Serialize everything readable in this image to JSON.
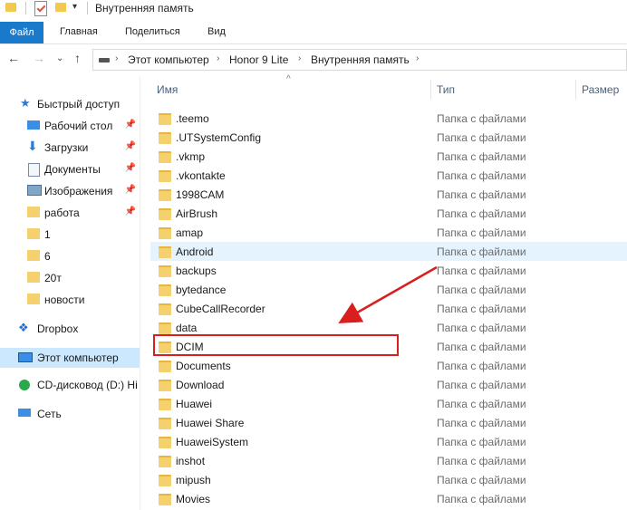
{
  "window": {
    "title": "Внутренняя память"
  },
  "ribbon": {
    "tabs": [
      "Файл",
      "Главная",
      "Поделиться",
      "Вид"
    ]
  },
  "address": {
    "crumbs": [
      "Этот компьютер",
      "Honor 9 Lite",
      "Внутренняя память"
    ]
  },
  "sidebar": {
    "items": [
      {
        "label": "Быстрый доступ",
        "icon": "star-icon",
        "pinned": false
      },
      {
        "label": "Рабочий стол",
        "icon": "desktop-icon",
        "pinned": true
      },
      {
        "label": "Загрузки",
        "icon": "download-arrow-icon",
        "pinned": true
      },
      {
        "label": "Документы",
        "icon": "documents-icon",
        "pinned": true
      },
      {
        "label": "Изображения",
        "icon": "pictures-icon",
        "pinned": true
      },
      {
        "label": "работа",
        "icon": "folder-sync-icon",
        "pinned": true
      },
      {
        "label": "1",
        "icon": "folder-icon",
        "pinned": false
      },
      {
        "label": "6",
        "icon": "folder-icon",
        "pinned": false
      },
      {
        "label": "20т",
        "icon": "folder-icon",
        "pinned": false
      },
      {
        "label": "новости",
        "icon": "folder-icon",
        "pinned": false
      },
      {
        "label": "Dropbox",
        "icon": "dropbox-icon",
        "pinned": false
      },
      {
        "label": "Этот компьютер",
        "icon": "computer-icon",
        "pinned": false,
        "selected": true
      },
      {
        "label": "CD-дисковод (D:) Hi",
        "icon": "cd-drive-icon",
        "pinned": false
      },
      {
        "label": "Сеть",
        "icon": "network-icon",
        "pinned": false
      }
    ]
  },
  "columns": {
    "name": "Имя",
    "type": "Тип",
    "size": "Размер"
  },
  "files": [
    {
      "name": ".teemo",
      "type": "Папка с файлами"
    },
    {
      "name": ".UTSystemConfig",
      "type": "Папка с файлами"
    },
    {
      "name": ".vkmp",
      "type": "Папка с файлами"
    },
    {
      "name": ".vkontakte",
      "type": "Папка с файлами"
    },
    {
      "name": "1998CAM",
      "type": "Папка с файлами"
    },
    {
      "name": "AirBrush",
      "type": "Папка с файлами"
    },
    {
      "name": "amap",
      "type": "Папка с файлами"
    },
    {
      "name": "Android",
      "type": "Папка с файлами"
    },
    {
      "name": "backups",
      "type": "Папка с файлами"
    },
    {
      "name": "bytedance",
      "type": "Папка с файлами"
    },
    {
      "name": "CubeCallRecorder",
      "type": "Папка с файлами"
    },
    {
      "name": "data",
      "type": "Папка с файлами"
    },
    {
      "name": "DCIM",
      "type": "Папка с файлами"
    },
    {
      "name": "Documents",
      "type": "Папка с файлами"
    },
    {
      "name": "Download",
      "type": "Папка с файлами"
    },
    {
      "name": "Huawei",
      "type": "Папка с файлами"
    },
    {
      "name": "Huawei Share",
      "type": "Папка с файлами"
    },
    {
      "name": "HuaweiSystem",
      "type": "Папка с файлами"
    },
    {
      "name": "inshot",
      "type": "Папка с файлами"
    },
    {
      "name": "mipush",
      "type": "Папка с файлами"
    },
    {
      "name": "Movies",
      "type": "Папка с файлами"
    }
  ],
  "colors": {
    "accent": "#1979ca",
    "highlight": "#d91e1e",
    "selected": "#cce8ff",
    "hover": "#e5f3ff"
  }
}
